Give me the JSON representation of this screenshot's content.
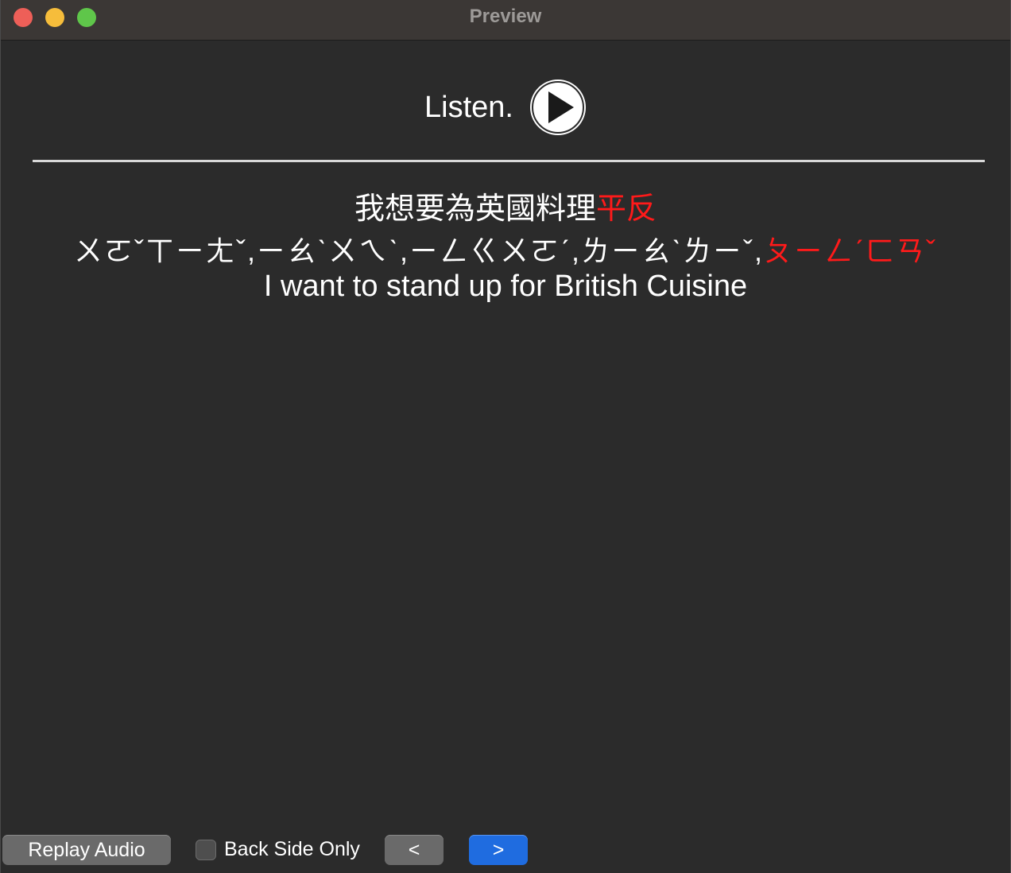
{
  "window": {
    "title": "Preview"
  },
  "card": {
    "listen_label": "Listen.",
    "hanzi": {
      "plain": "我想要為英國料理",
      "highlight": "平反"
    },
    "bopomofo": {
      "plain": "ㄨㄛˇㄒㄧㄤˇ,ㄧㄠˋㄨㄟˋ,ㄧㄥㄍㄨㄛˊ,ㄌㄧㄠˋㄌㄧˇ,",
      "highlight": "ㄆㄧㄥˊㄈㄢˇ"
    },
    "english": "I want to stand up for British Cuisine"
  },
  "colors": {
    "highlight": "#ff1a1a",
    "primary_button": "#1f6ce0"
  },
  "toolbar": {
    "replay_label": "Replay Audio",
    "back_side_only_label": "Back Side Only",
    "back_side_only_checked": false,
    "prev_label": "<",
    "next_label": ">"
  }
}
